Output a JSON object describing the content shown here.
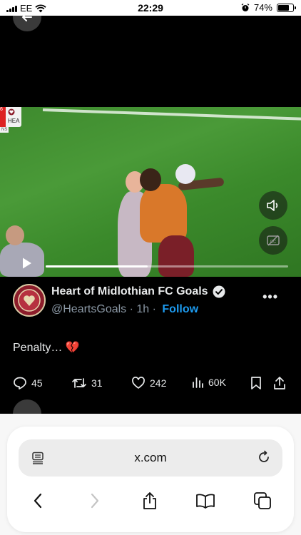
{
  "status_bar": {
    "carrier": "EE",
    "time": "22:29",
    "battery_text": "74%",
    "battery_level": 0.74
  },
  "video": {
    "score_badge": {
      "team": "HEA",
      "sub": "NS",
      "number": "6"
    },
    "progress": 0.42
  },
  "tweet": {
    "author_name": "Heart of Midlothian FC Goals",
    "handle": "@HeartsGoals",
    "time_sep": " · 1h · ",
    "follow_label": "Follow",
    "more_label": "•••",
    "text": "Penalty…",
    "text_emoji": "💔",
    "stats": {
      "replies": "45",
      "reposts": "31",
      "likes": "242",
      "views": "60K"
    }
  },
  "browser": {
    "url": "x.com"
  },
  "colors": {
    "accent": "#1d9bf0",
    "background": "#000000",
    "avatar": "#8c1d2b"
  }
}
